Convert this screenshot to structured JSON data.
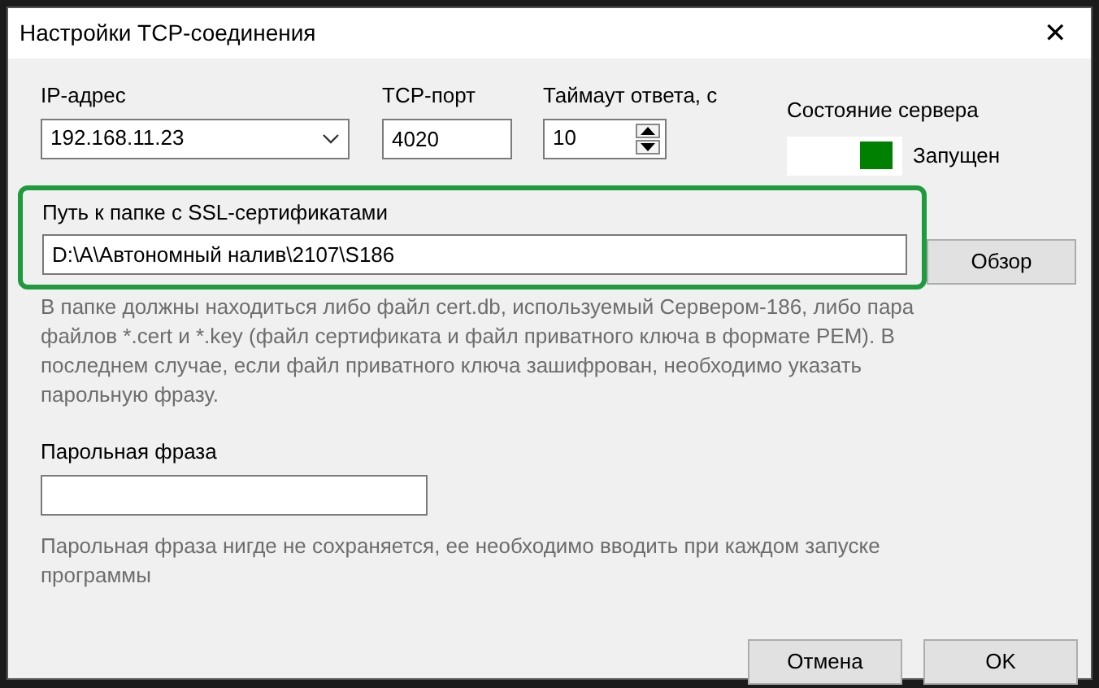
{
  "window": {
    "title": "Настройки TCP-соединения",
    "close": "✕"
  },
  "ip": {
    "label": "IP-адрес",
    "value": "192.168.11.23"
  },
  "port": {
    "label": "TCP-порт",
    "value": "4020"
  },
  "timeout": {
    "label": "Таймаут ответа, с",
    "value": "10"
  },
  "server_status": {
    "label": "Состояние сервера",
    "text": "Запущен",
    "running": true
  },
  "cert_path": {
    "label": "Путь к папке с SSL-сертификатами",
    "value": "D:\\A\\Автономный налив\\2107\\S186",
    "highlighted": true,
    "browse": "Обзор",
    "hint": "В папке должны находиться либо файл cert.db, используемый Сервером-186, либо пара файлов *.cert и *.key (файл сертификата и файл приватного ключа в формате PEM). В последнем случае, если файл приватного ключа зашифрован, необходимо указать парольную фразу."
  },
  "passphrase": {
    "label": "Парольная фраза",
    "hint": "Парольная фраза нигде не сохраняется, ее необходимо вводить при каждом запуске программы"
  },
  "buttons": [
    "Отмена",
    "OK"
  ]
}
